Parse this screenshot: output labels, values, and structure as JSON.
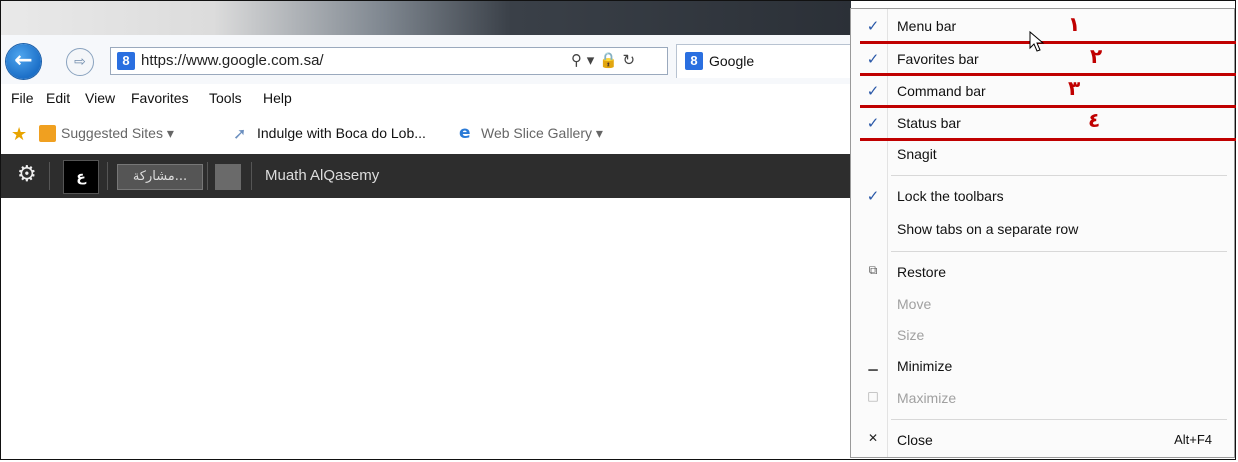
{
  "address_bar": {
    "url": "https://www.google.com.sa/",
    "search_lock_refresh_glyphs": "⚲ ▾ 🔒 ↻"
  },
  "tab": {
    "title": "Google",
    "favicon": "8"
  },
  "menu_bar": {
    "items": [
      "File",
      "Edit",
      "View",
      "Favorites",
      "Tools",
      "Help"
    ]
  },
  "favorites_bar": {
    "items": [
      "Suggested Sites ▾",
      "Indulge with Boca do Lob...",
      "Web Slice Gallery ▾"
    ]
  },
  "command_bar": {
    "share_label": "مشاركة...",
    "user_name": "Muath AlQasemy",
    "logo_text": "ع"
  },
  "context_menu": {
    "items": [
      {
        "label": "Menu bar",
        "check": "✓"
      },
      {
        "label": "Favorites bar",
        "check": "✓"
      },
      {
        "label": "Command bar",
        "check": "✓"
      },
      {
        "label": "Status bar",
        "check": "✓"
      },
      {
        "label": "Snagit",
        "check": ""
      },
      {
        "label": "Lock the toolbars",
        "check": "✓"
      },
      {
        "label": "Show tabs on a separate row",
        "check": ""
      },
      {
        "label": "Restore",
        "glyph": "⧉"
      },
      {
        "label": "Move",
        "glyph": ""
      },
      {
        "label": "Size",
        "glyph": ""
      },
      {
        "label": "Minimize",
        "glyph": "▁"
      },
      {
        "label": "Maximize",
        "glyph": "□"
      },
      {
        "label": "Close",
        "glyph": "✕",
        "accel": "Alt+F4"
      }
    ]
  },
  "annotations": [
    "١",
    "٢",
    "٣",
    "٤"
  ],
  "colors": {
    "annotation_red": "#c00000",
    "check_blue": "#2a58a8"
  }
}
